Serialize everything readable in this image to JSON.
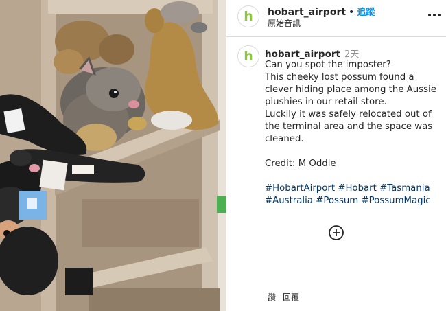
{
  "post": {
    "image": {
      "description_icon": "possum-among-plush-toys-photo"
    }
  },
  "header": {
    "username": "hobart_airport",
    "separator": "•",
    "follow_label": "追蹤",
    "subtitle": "原始音訊",
    "more_icon": "more-options-icon"
  },
  "caption": {
    "username": "hobart_airport",
    "time": "2天",
    "lines": [
      "Can you spot the imposter?",
      "This cheeky lost possum found a",
      "clever hiding place among the Aussie",
      "plushies in our retail store.",
      "Luckily it was safely relocated out of",
      "the terminal area and the space was",
      "cleaned.",
      "",
      "Credit: M Oddie",
      ""
    ],
    "hashtags_line1": [
      "#HobartAirport",
      "#Hobart",
      "#Tasmania"
    ],
    "hashtags_line2": [
      "#Australia",
      "#Possum",
      "#PossumMagic"
    ]
  },
  "footer": {
    "likes_label": "讚",
    "reply_label": "回覆"
  },
  "colors": {
    "accent": "#0095f6",
    "hashtag": "#00376b",
    "brand_green": "#8dc63f"
  }
}
